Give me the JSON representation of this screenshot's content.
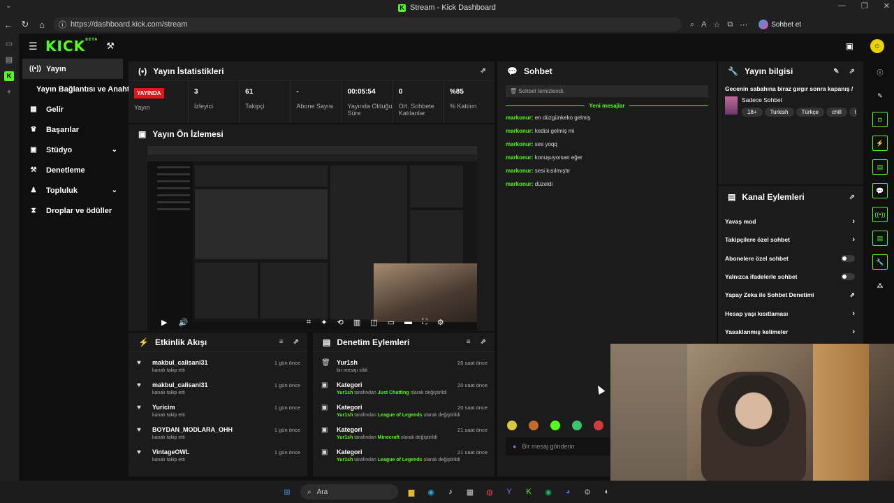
{
  "window": {
    "title": "Stream - Kick Dashboard"
  },
  "browser": {
    "url": "https://dashboard.kick.com/stream",
    "chat_button": "Sohbet et"
  },
  "sidebar": {
    "items": [
      {
        "label": "Yayın",
        "icon": "broadcast-icon",
        "active": true
      },
      {
        "label": "Yayın Bağlantısı ve Anahtarı",
        "icon": ""
      },
      {
        "label": "Gelir",
        "icon": "revenue-icon"
      },
      {
        "label": "Başarılar",
        "icon": "trophy-icon"
      },
      {
        "label": "Stüdyo",
        "icon": "studio-icon",
        "chevron": true
      },
      {
        "label": "Denetleme",
        "icon": "moderation-icon"
      },
      {
        "label": "Topluluk",
        "icon": "community-icon",
        "chevron": true
      },
      {
        "label": "Droplar ve ödüller",
        "icon": "drops-icon"
      }
    ]
  },
  "stats": {
    "title": "Yayın İstatistikleri",
    "live_badge": "YAYINDA",
    "live_label": "Yayın",
    "cells": [
      {
        "value": "3",
        "label": "İzleyici"
      },
      {
        "value": "61",
        "label": "Takipçi"
      },
      {
        "value": "-",
        "label": "Abone Sayısı"
      },
      {
        "value": "00:05:54",
        "label": "Yayında Olduğu Süre"
      },
      {
        "value": "0",
        "label": "Ort. Sohbete Katılanlar"
      },
      {
        "value": "%85",
        "label": "% Katılım"
      }
    ]
  },
  "preview": {
    "title": "Yayın Ön İzlemesi"
  },
  "activity": {
    "title": "Etkinlik Akışı",
    "items": [
      {
        "user": "makbul_calisani31",
        "action": "kanalı takip etti",
        "time": "1 gün önce"
      },
      {
        "user": "makbul_calisani31",
        "action": "kanalı takip etti",
        "time": "1 gün önce"
      },
      {
        "user": "Yuricim",
        "action": "kanalı takip etti",
        "time": "1 gün önce"
      },
      {
        "user": "BOYDAN_MODLARA_OHH",
        "action": "kanalı takip etti",
        "time": "1 gün önce"
      },
      {
        "user": "VintageOWL",
        "action": "kanalı takip etti",
        "time": "1 gün önce"
      }
    ]
  },
  "moderation": {
    "title": "Denetim Eylemleri",
    "items": [
      {
        "title": "Yur1sh",
        "pre": "",
        "mid": "bir mesajı sildi",
        "cat": "",
        "post": "",
        "time": "20 saat önce",
        "icon": "trash-icon"
      },
      {
        "title": "Kategori",
        "pre": "Yur1sh",
        "mid": " tarafından ",
        "cat": "Just Chatting",
        "post": " olarak değiştirildi",
        "time": "20 saat önce",
        "icon": "category-icon"
      },
      {
        "title": "Kategori",
        "pre": "Yur1sh",
        "mid": " tarafından ",
        "cat": "League of Legends",
        "post": " olarak değiştirildi",
        "time": "20 saat önce",
        "icon": "category-icon"
      },
      {
        "title": "Kategori",
        "pre": "Yur1sh",
        "mid": " tarafından ",
        "cat": "Minecraft",
        "post": " olarak değiştirildi",
        "time": "21 saat önce",
        "icon": "category-icon"
      },
      {
        "title": "Kategori",
        "pre": "Yur1sh",
        "mid": " tarafından ",
        "cat": "League of Legends",
        "post": " olarak değiştirildi",
        "time": "21 saat önce",
        "icon": "category-icon"
      }
    ]
  },
  "chat": {
    "title": "Sohbet",
    "cleared": "Sohbet temizlendi.",
    "new_messages": "Yeni mesajlar",
    "messages": [
      {
        "user": "markonur",
        "text": "en düzgünkeko gelmiş"
      },
      {
        "user": "markonur",
        "text": "kedisi gelmiş mi"
      },
      {
        "user": "markonur",
        "text": "ses yoqq"
      },
      {
        "user": "markonur",
        "text": "konuşuyorsan eğer"
      },
      {
        "user": "markonur",
        "text": "sesi kısılmıştır"
      },
      {
        "user": "markonur",
        "text": "düzeldi"
      }
    ],
    "placeholder": "Bir mesaj gönderin"
  },
  "stream_info": {
    "title": "Yayın bilgisi",
    "stream_title": "Gecenin sabahına biraz gırgır sonra kapanış /",
    "category": "Sadece Sohbet",
    "tags": [
      "18+",
      "Turkish",
      "Türkçe",
      "chill",
      "türk"
    ]
  },
  "channel_actions": {
    "title": "Kanal Eylemleri",
    "items": [
      {
        "label": "Yavaş mod",
        "type": "arrow"
      },
      {
        "label": "Takipçilere özel sohbet",
        "type": "arrow"
      },
      {
        "label": "Abonelere özel sohbet",
        "type": "toggle"
      },
      {
        "label": "Yalnızca ifadelerle sohbet",
        "type": "toggle"
      },
      {
        "label": "Yapay Zeka ile Sohbet Denetimi",
        "type": "external"
      },
      {
        "label": "Hesap yaşı kısıtlaması",
        "type": "arrow"
      },
      {
        "label": "Yasaklanmış kelimeler",
        "type": "arrow"
      }
    ]
  },
  "taskbar": {
    "search": "Ara"
  },
  "colors": {
    "accent": "#53fc18",
    "live": "#e3161b",
    "panel": "#1b1b1b",
    "background": "#0f0f0f"
  }
}
